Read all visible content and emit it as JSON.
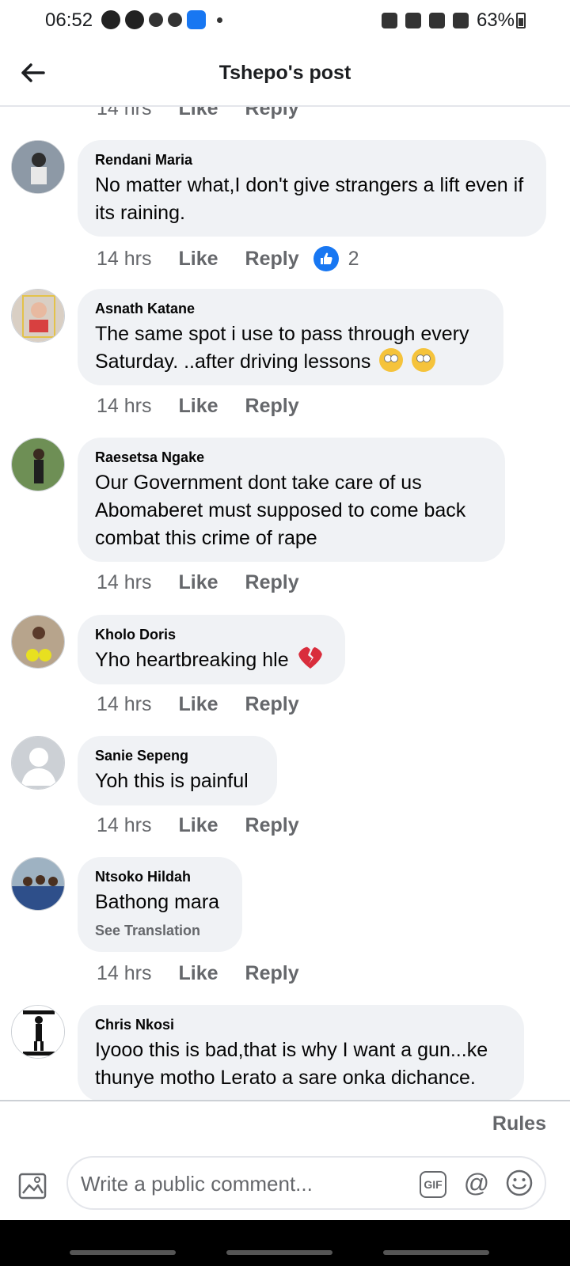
{
  "status_bar": {
    "time": "06:52",
    "battery": "63%"
  },
  "header": {
    "title": "Tshepo's post"
  },
  "top_partial": {
    "time": "14 hrs",
    "like": "Like",
    "reply": "Reply"
  },
  "comments": [
    {
      "author": "Rendani Maria",
      "text": "No matter what,I don't give strangers a lift even if its raining.",
      "time": "14 hrs",
      "like": "Like",
      "reply": "Reply",
      "like_count": "2"
    },
    {
      "author": "Asnath Katane",
      "text": "The same spot i use to pass through every Saturday. ..after driving lessons",
      "time": "14 hrs",
      "like": "Like",
      "reply": "Reply"
    },
    {
      "author": "Raesetsa Ngake",
      "text": "Our Government dont take care of us Abomaberet must supposed to come back combat this crime of rape",
      "time": "14 hrs",
      "like": "Like",
      "reply": "Reply"
    },
    {
      "author": "Kholo Doris",
      "text": "Yho heartbreaking hle",
      "time": "14 hrs",
      "like": "Like",
      "reply": "Reply"
    },
    {
      "author": "Sanie Sepeng",
      "text": "Yoh this is painful",
      "time": "14 hrs",
      "like": "Like",
      "reply": "Reply"
    },
    {
      "author": "Ntsoko Hildah",
      "text": "Bathong mara",
      "see_translation": "See Translation",
      "time": "14 hrs",
      "like": "Like",
      "reply": "Reply"
    },
    {
      "author": "Chris Nkosi",
      "text": "Iyooo this is bad,that is why I want a gun...ke thunye motho Lerato a sare onka dichance."
    }
  ],
  "footer": {
    "rules": "Rules",
    "comment_placeholder": "Write a public comment...",
    "gif_label": "GIF",
    "at_label": "@"
  },
  "colors": {
    "accent": "#1877f2",
    "bubble": "#f0f2f5",
    "secondary_text": "#65676b"
  }
}
